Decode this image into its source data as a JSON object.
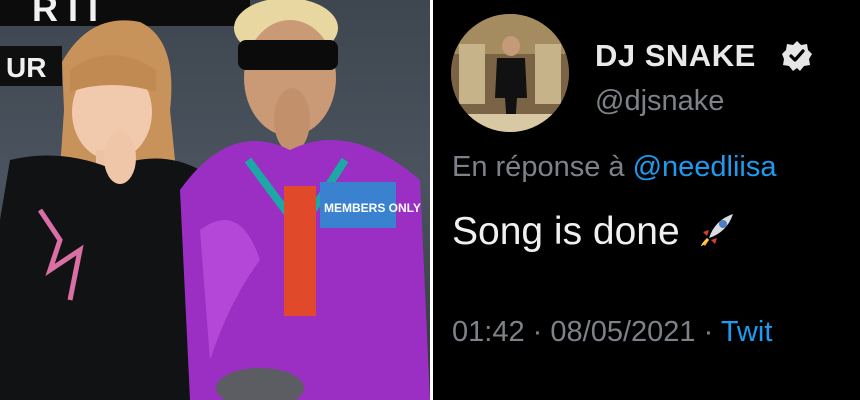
{
  "photo": {
    "sign_top": "RTI",
    "sign_left": "UR",
    "jacket_patch": "MEMBERS ONLY"
  },
  "tweet": {
    "display_name": "DJ SNAKE",
    "handle": "@djsnake",
    "reply_prefix": "En réponse à",
    "reply_to": "@needliisa",
    "text": "Song is done",
    "emoji": "rocket-icon",
    "time": "01:42",
    "separator": "·",
    "date": "08/05/2021",
    "source": "Twit"
  },
  "colors": {
    "tweet_background": "#000000",
    "primary_text": "#f0f0f1",
    "secondary_text": "#7d8188",
    "link": "#1d9bf0",
    "jacket": "#9b2fc4"
  }
}
